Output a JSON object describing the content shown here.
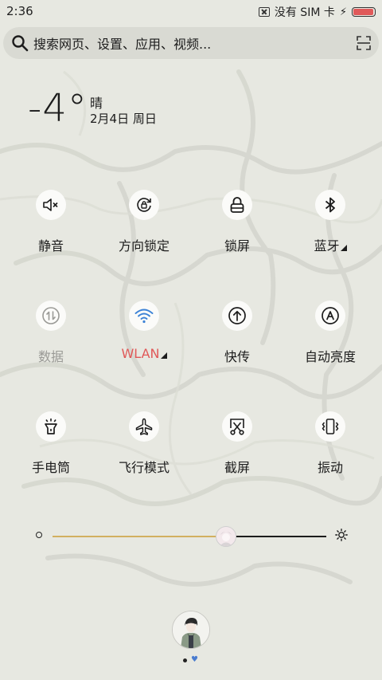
{
  "status_bar": {
    "time": "2:36",
    "sim_text": "没有 SIM 卡",
    "battery_level": 0.95,
    "battery_color": "#e05a5a"
  },
  "search": {
    "placeholder": "搜索网页、设置、应用、视频..."
  },
  "weather": {
    "temperature": "-4°",
    "condition": "晴",
    "date": "2月4日 周日"
  },
  "tiles": [
    {
      "label": "静音",
      "icon": "speaker-mute-icon",
      "state": "off"
    },
    {
      "label": "方向锁定",
      "icon": "rotation-lock-icon",
      "state": "off"
    },
    {
      "label": "锁屏",
      "icon": "lock-icon",
      "state": "off"
    },
    {
      "label": "蓝牙",
      "icon": "bluetooth-icon",
      "state": "off",
      "has_more": true
    },
    {
      "label": "数据",
      "icon": "mobile-data-icon",
      "state": "disabled"
    },
    {
      "label": "WLAN",
      "icon": "wifi-icon",
      "state": "on",
      "has_more": true
    },
    {
      "label": "快传",
      "icon": "quick-transfer-icon",
      "state": "off"
    },
    {
      "label": "自动亮度",
      "icon": "auto-brightness-icon",
      "state": "off"
    },
    {
      "label": "手电筒",
      "icon": "flashlight-icon",
      "state": "off"
    },
    {
      "label": "飞行模式",
      "icon": "airplane-icon",
      "state": "off"
    },
    {
      "label": "截屏",
      "icon": "screenshot-icon",
      "state": "off"
    },
    {
      "label": "振动",
      "icon": "vibrate-icon",
      "state": "off"
    }
  ],
  "brightness": {
    "level": 0.63,
    "track_active_color": "#d2b060"
  },
  "colors": {
    "accent_on": "#e05858",
    "wifi_blue": "#3b82d6"
  },
  "pager": {
    "pages": 2,
    "current": 2
  }
}
